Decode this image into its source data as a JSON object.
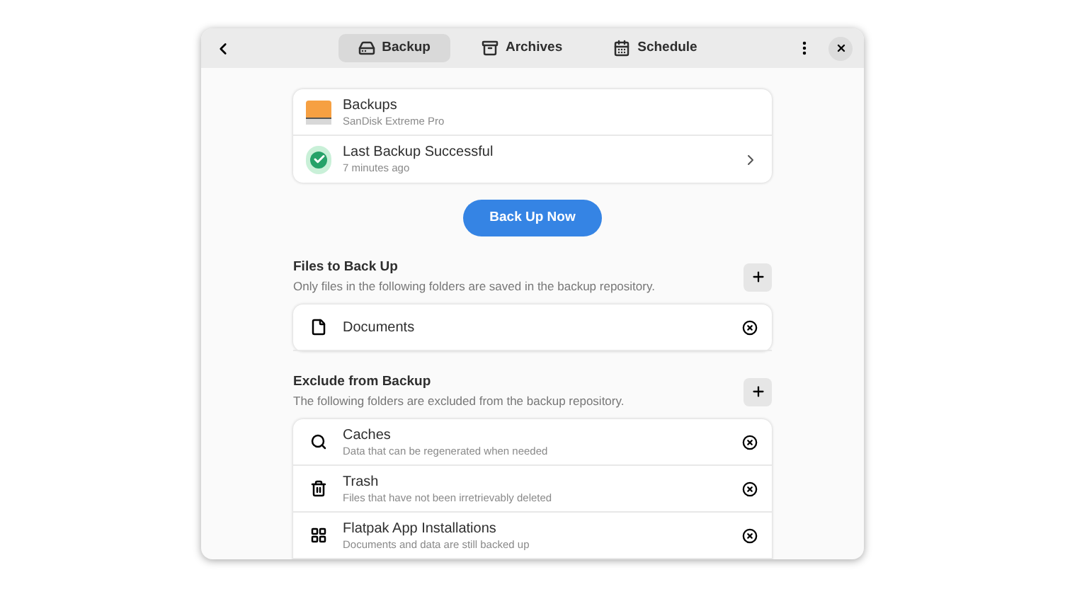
{
  "header": {
    "tabs": [
      {
        "label": "Backup",
        "kind": "backup",
        "selected": true
      },
      {
        "label": "Archives",
        "kind": "archives",
        "selected": false
      },
      {
        "label": "Schedule",
        "kind": "schedule",
        "selected": false
      }
    ]
  },
  "status_card": [
    {
      "kind": "drive",
      "title": "Backups",
      "subtitle": "SanDisk Extreme Pro"
    },
    {
      "kind": "success",
      "title": "Last Backup Successful",
      "subtitle": "7 minutes ago"
    }
  ],
  "primary_button": "Back Up Now",
  "sections": [
    {
      "title": "Files to Back Up",
      "description": "Only files in the following folders are saved in the backup repository.",
      "items": [
        {
          "kind": "document",
          "title": "Documents"
        }
      ]
    },
    {
      "title": "Exclude from Backup",
      "description": "The following folders are excluded from the backup repository.",
      "items": [
        {
          "kind": "search",
          "title": "Caches",
          "subtitle": "Data that can be regenerated when needed"
        },
        {
          "kind": "trash",
          "title": "Trash",
          "subtitle": "Files that have not been irretrievably deleted"
        },
        {
          "kind": "grid",
          "title": "Flatpak App Installations",
          "subtitle": "Documents and data are still backed up"
        }
      ]
    }
  ]
}
